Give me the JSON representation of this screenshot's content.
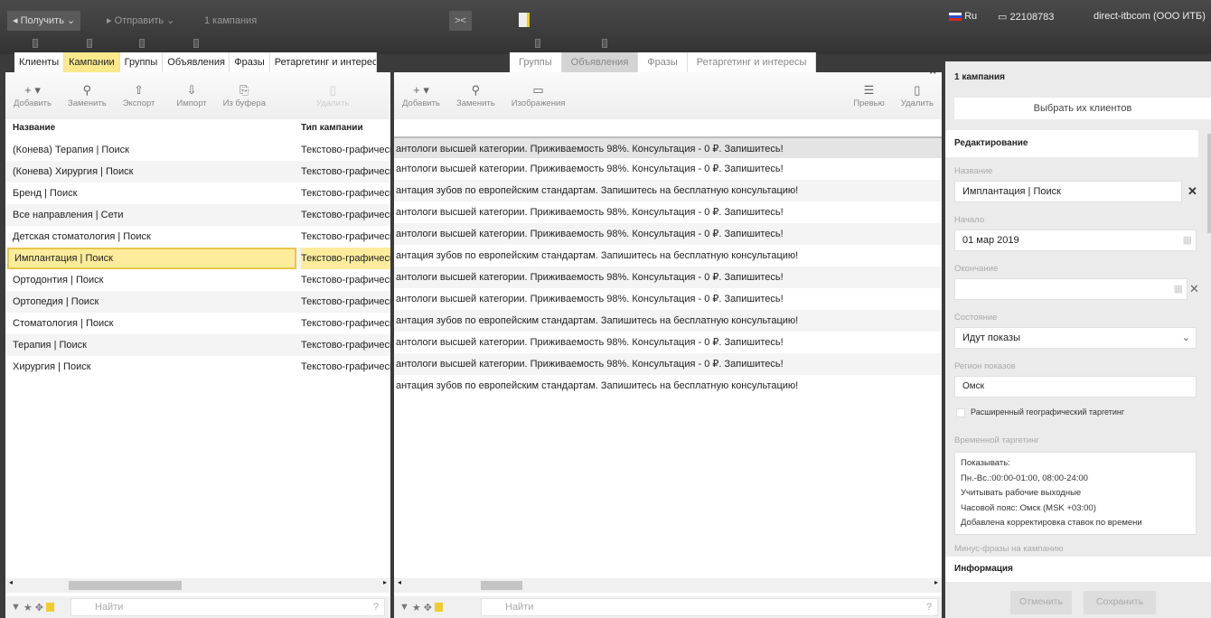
{
  "topbar": {
    "get_label": "Получить",
    "send_label": "Отправить",
    "campaign_count": "1 кампания",
    "language": "Ru",
    "account_id": "22108783",
    "user": "direct-itbcom (ООО ИТБ)"
  },
  "left": {
    "tabs": [
      "Клиенты",
      "Кампании",
      "Группы",
      "Объявления",
      "Фразы",
      "Ретаргетинг и интересы"
    ],
    "toolbar": [
      "Добавить",
      "Заменить",
      "Экспорт",
      "Импорт",
      "Из буфера",
      "Удалить"
    ],
    "columns": [
      "Название",
      "Тип кампании"
    ],
    "rows": [
      {
        "name": "(Конева) Терапия | Поиск",
        "type": "Текстово-графические"
      },
      {
        "name": "(Конева) Хирургия | Поиск",
        "type": "Текстово-графические"
      },
      {
        "name": "Бренд | Поиск",
        "type": "Текстово-графические"
      },
      {
        "name": "Все направления | Сети",
        "type": "Текстово-графические"
      },
      {
        "name": "Детская стоматология | Поиск",
        "type": "Текстово-графические"
      },
      {
        "name": "Имплантация | Поиск",
        "type": "Текстово-графические"
      },
      {
        "name": "Ортодонтия | Поиск",
        "type": "Текстово-графические"
      },
      {
        "name": "Ортопедия | Поиск",
        "type": "Текстово-графические"
      },
      {
        "name": "Стоматология | Поиск",
        "type": "Текстово-графические"
      },
      {
        "name": "Терапия | Поиск",
        "type": "Текстово-графические"
      },
      {
        "name": "Хирургия | Поиск",
        "type": "Текстово-графические"
      }
    ],
    "selected_index": 5,
    "search_placeholder": "Найти",
    "help": "?"
  },
  "middle": {
    "tabs": [
      "Группы",
      "Объявления",
      "Фразы",
      "Ретаргетинг и интересы"
    ],
    "toolbar_left": [
      "Добавить",
      "Заменить",
      "Изображения"
    ],
    "toolbar_right": [
      "Превью",
      "Удалить"
    ],
    "rows": [
      "антологи высшей категории. Приживаемость 98%. Консультация - 0 ₽. Запишитесь!",
      "антологи высшей категории. Приживаемость 98%. Консультация - 0 ₽. Запишитесь!",
      "антация зубов по европейским стандартам. Запишитесь на бесплатную консультацию!",
      "антологи высшей категории. Приживаемость 98%. Консультация - 0 ₽. Запишитесь!",
      "антологи высшей категории. Приживаемость 98%. Консультация - 0 ₽. Запишитесь!",
      "антация зубов по европейским стандартам. Запишитесь на бесплатную консультацию!",
      "антологи высшей категории. Приживаемость 98%. Консультация - 0 ₽. Запишитесь!",
      "антологи высшей категории. Приживаемость 98%. Консультация - 0 ₽. Запишитесь!",
      "антация зубов по европейским стандартам. Запишитесь на бесплатную консультацию!",
      "антологи высшей категории. Приживаемость 98%. Консультация - 0 ₽. Запишитесь!",
      "антологи высшей категории. Приживаемость 98%. Консультация - 0 ₽. Запишитесь!",
      "антация зубов по европейским стандартам. Запишитесь на бесплатную консультацию!"
    ],
    "search_placeholder": "Найти",
    "help": "?"
  },
  "right": {
    "title": "1 кампания",
    "select_clients": "Выбрать их клиентов",
    "editing": "Редактирование",
    "name_label": "Название",
    "name_value": "Имплантация | Поиск",
    "start_label": "Начало",
    "start_value": "01 мар 2019",
    "end_label": "Окончание",
    "end_value": "",
    "state_label": "Состояние",
    "state_value": "Идут показы",
    "region_label": "Регион показов",
    "region_value": "Омск",
    "geo_checkbox": "Расширенный географический таргетинг",
    "time_label": "Временной таргетинг",
    "time_lines": [
      "Показывать:",
      "Пн.-Вс.:00:00-01:00, 08:00-24:00",
      "Учитывать рабочие выходные",
      "Часовой пояс: Омск (MSK +03:00)",
      "Добавлена корректировка ставок по времени"
    ],
    "minus_label": "Минус-фразы на кампанию",
    "info": "Информация",
    "cancel": "Отменить",
    "save": "Сохранить"
  }
}
